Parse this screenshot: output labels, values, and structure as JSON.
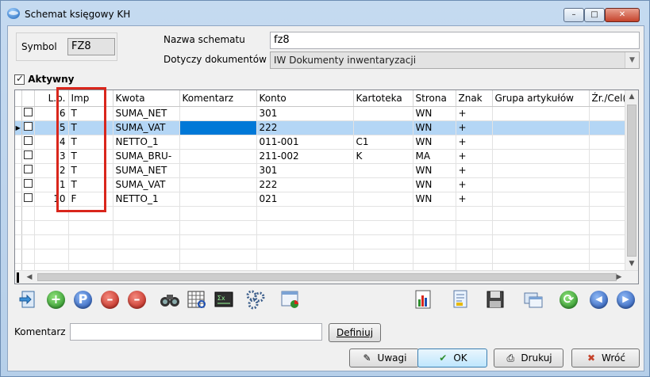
{
  "window": {
    "title": "Schemat księgowy KH",
    "controls": {
      "minimize": "–",
      "maximize": "□",
      "close": "✕"
    }
  },
  "form": {
    "symbol_label": "Symbol",
    "symbol_value": "FZ8",
    "name_label": "Nazwa schematu",
    "name_value": "fz8",
    "docs_label": "Dotyczy dokumentów",
    "docs_value": "IW Dokumenty inwentaryzacji",
    "active_label": "Aktywny",
    "active_checked": true
  },
  "grid": {
    "columns": [
      "L.p.",
      "Imp",
      "Kwota",
      "Komentarz",
      "Konto",
      "Kartoteka",
      "Strona",
      "Znak",
      "Grupa artykułów",
      "Źr./Cel(M"
    ],
    "rows": [
      {
        "lp": "6",
        "imp": "T",
        "kwota": "SUMA_NET",
        "komentarz": "",
        "konto": "301",
        "kartoteka": "",
        "strona": "WN",
        "znak": "+"
      },
      {
        "lp": "5",
        "imp": "T",
        "kwota": "SUMA_VAT",
        "komentarz": "",
        "konto": "222",
        "kartoteka": "",
        "strona": "WN",
        "znak": "+"
      },
      {
        "lp": "4",
        "imp": "T",
        "kwota": "NETTO_1",
        "komentarz": "",
        "konto": "011-001",
        "kartoteka": "C1",
        "strona": "WN",
        "znak": "+"
      },
      {
        "lp": "3",
        "imp": "T",
        "kwota": "SUMA_BRU-",
        "komentarz": "",
        "konto": "211-002",
        "kartoteka": "K",
        "strona": "MA",
        "znak": "+"
      },
      {
        "lp": "2",
        "imp": "T",
        "kwota": "SUMA_NET",
        "komentarz": "",
        "konto": "301",
        "kartoteka": "",
        "strona": "WN",
        "znak": "+"
      },
      {
        "lp": "1",
        "imp": "T",
        "kwota": "SUMA_VAT",
        "komentarz": "",
        "konto": "222",
        "kartoteka": "",
        "strona": "WN",
        "znak": "+"
      },
      {
        "lp": "10",
        "imp": "F",
        "kwota": "NETTO_1",
        "komentarz": "",
        "konto": "021",
        "kartoteka": "",
        "strona": "WN",
        "znak": "+"
      }
    ],
    "selected_row": "5",
    "current_row_marker": "▶"
  },
  "toolbar": {
    "icons": [
      "export-icon",
      "add-icon",
      "preview-icon",
      "delete-icon",
      "delete-checked-icon",
      "binoculars-icon",
      "table-search-icon",
      "calculator-icon",
      "gears-icon",
      "chart-window-icon",
      "report-chart-icon",
      "document-icon",
      "save-icon",
      "windows-icon",
      "refresh-icon",
      "first-record-icon",
      "next-record-icon"
    ],
    "add_glyph": "+",
    "preview_glyph": "P",
    "delete_glyph": "–",
    "first_glyph": "◀",
    "next_glyph": "▶"
  },
  "comment": {
    "label": "Komentarz",
    "value": "",
    "define_button": "Definiuj"
  },
  "buttons": {
    "notes": "Uwagi",
    "ok": "OK",
    "print": "Drukuj",
    "back": "Wróć"
  },
  "colors": {
    "selection": "#b4d6f5",
    "edit_cell": "#0078d7",
    "highlight_box": "#d9261c"
  }
}
